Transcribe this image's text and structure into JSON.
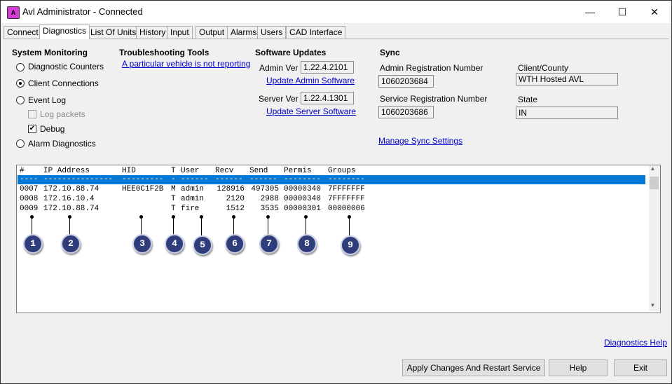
{
  "window": {
    "title": "Avl Administrator - Connected",
    "icon_text": "A",
    "minimize": "—",
    "maximize": "☐",
    "close": "✕"
  },
  "tabs": [
    {
      "label": "Connect"
    },
    {
      "label": "Diagnostics"
    },
    {
      "label": "List Of Units"
    },
    {
      "label": "History"
    },
    {
      "label": "Input"
    },
    {
      "label": "Output"
    },
    {
      "label": "Alarms"
    },
    {
      "label": "Users"
    },
    {
      "label": "CAD Interface"
    }
  ],
  "system_monitoring": {
    "header": "System Monitoring",
    "diagnostic_counters": "Diagnostic Counters",
    "client_connections": "Client Connections",
    "event_log": "Event Log",
    "log_packets": "Log packets",
    "debug": "Debug",
    "alarm_diagnostics": "Alarm Diagnostics",
    "selected": "Client Connections"
  },
  "troubleshooting": {
    "header": "Troubleshooting Tools",
    "link": "A particular vehicle is not reporting"
  },
  "software_updates": {
    "header": "Software Updates",
    "admin_ver_label": "Admin Ver",
    "admin_ver": "1.22.4.2101",
    "update_admin": "Update Admin Software",
    "server_ver_label": "Server Ver",
    "server_ver": "1.22.4.1301",
    "update_server": "Update Server Software"
  },
  "sync": {
    "header": "Sync",
    "admin_reg_label": "Admin Registration Number",
    "admin_reg": "1060203684",
    "service_reg_label": "Service Registration Number",
    "service_reg": "1060203686",
    "manage_link": "Manage Sync Settings",
    "client_county_label": "Client/County",
    "client_county": "WTH Hosted AVL",
    "state_label": "State",
    "state": "IN"
  },
  "connections_table": {
    "headers": [
      "#",
      "IP Address",
      "HID",
      "T",
      "User",
      "Recv",
      "Send",
      "Permis",
      "Groups"
    ],
    "separator": [
      "----",
      "---------------",
      "---------",
      "-",
      "------",
      "------",
      "------",
      "--------",
      "--------"
    ],
    "rows": [
      [
        "0007",
        "172.10.88.74",
        "HEE0C1F2B",
        "M",
        "admin",
        "128916",
        "497305",
        "00000340",
        "7FFFFFFF"
      ],
      [
        "0008",
        "172.16.10.4",
        "",
        "T",
        "admin",
        "2120",
        "2988",
        "00000340",
        "7FFFFFFF"
      ],
      [
        "0009",
        "172.10.88.74",
        "",
        "T",
        "fire",
        "1512",
        "3535",
        "00000301",
        "00000006"
      ]
    ]
  },
  "callouts": [
    "1",
    "2",
    "3",
    "4",
    "5",
    "6",
    "7",
    "8",
    "9"
  ],
  "diagnostics_help": "Diagnostics Help",
  "buttons": {
    "apply": "Apply Changes And Restart Service",
    "help": "Help",
    "exit": "Exit"
  },
  "scroll": {
    "up": "▲",
    "down": "▼"
  }
}
